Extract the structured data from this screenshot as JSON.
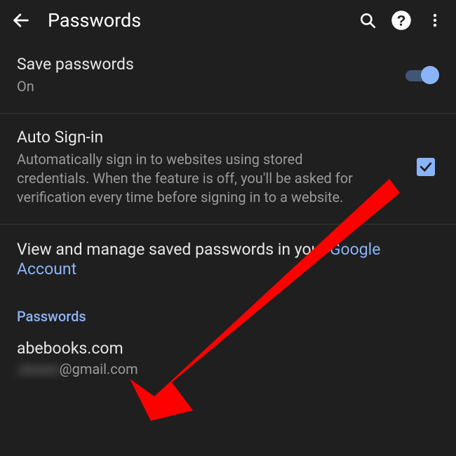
{
  "appbar": {
    "title": "Passwords"
  },
  "save_passwords": {
    "title": "Save passwords",
    "status": "On",
    "enabled": true
  },
  "auto_signin": {
    "title": "Auto Sign-in",
    "description": "Automatically sign in to websites using stored credentials. When the feature is off, you'll be asked for verification every time before signing in to a website.",
    "checked": true
  },
  "manage": {
    "prefix": "View and manage saved passwords in your ",
    "link": "Google Account"
  },
  "list": {
    "header": "Passwords",
    "items": [
      {
        "site": "abebooks.com",
        "user_masked": "Jxxxxx",
        "user_domain": "@gmail.com"
      }
    ]
  },
  "colors": {
    "background": "#1f1f1f",
    "accent": "#8ab4f8",
    "text_primary": "#e6e6e6",
    "text_secondary": "#9a9a9a",
    "annotation": "#ff0000"
  }
}
